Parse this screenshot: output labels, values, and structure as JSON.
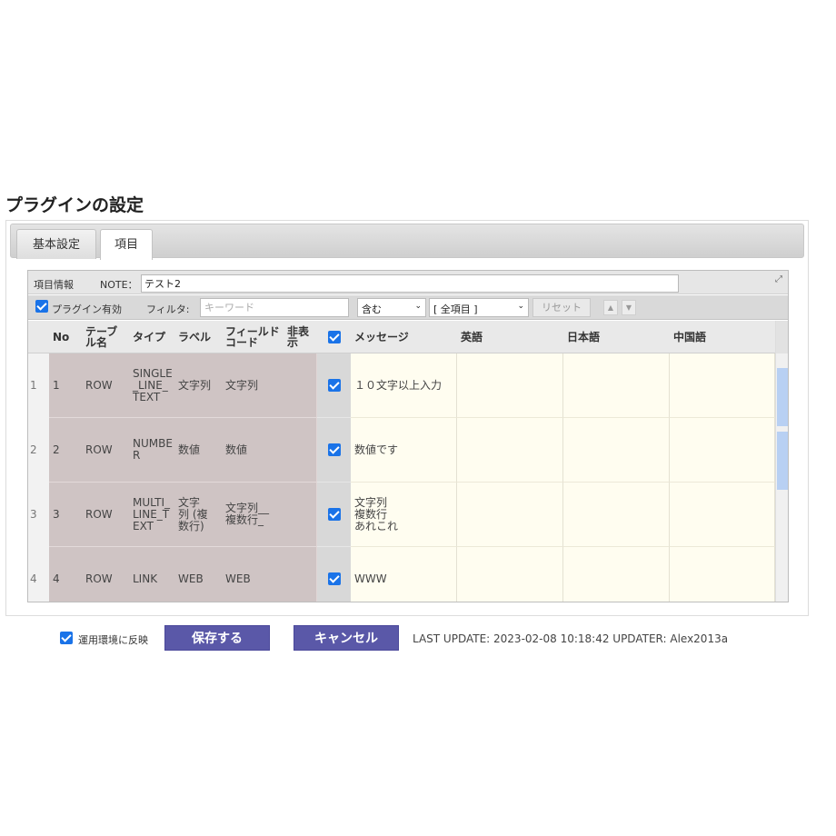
{
  "page": {
    "title": "プラグインの設定"
  },
  "tabs": [
    {
      "label": "基本設定",
      "active": false
    },
    {
      "label": "項目",
      "active": true
    }
  ],
  "grid": {
    "title_label": "項目情報",
    "note_label": "NOTE：",
    "note_value": "テスト2",
    "toolbar": {
      "plugin_enabled_label": "プラグイン有効",
      "plugin_enabled_checked": true,
      "filter_label": "フィルタ:",
      "keyword_placeholder": "キーワード",
      "match_mode": "含む",
      "field_scope": "[ 全項目 ]",
      "reset_label": "リセット"
    },
    "columns": {
      "no": "No",
      "table": "テーブ\nル名",
      "type": "タイプ",
      "label": "ラベル",
      "field_code": "フィールド\nコード",
      "hidden": "非表\n示",
      "message": "メッセージ",
      "en": "英語",
      "ja": "日本語",
      "zh": "中国語"
    },
    "rows": [
      {
        "rownum": "1",
        "no": "1",
        "table": "ROW",
        "type": "SINGLE\n_LINE_\nTEXT",
        "label": "文字列",
        "field_code": "文字列",
        "hidden": "",
        "checked": true,
        "message": "１０文字以上入力",
        "en": "",
        "ja": "",
        "zh": ""
      },
      {
        "rownum": "2",
        "no": "2",
        "table": "ROW",
        "type": "NUMBE\nR",
        "label": "数値",
        "field_code": "数値",
        "hidden": "",
        "checked": true,
        "message": "数値です",
        "en": "",
        "ja": "",
        "zh": ""
      },
      {
        "rownum": "3",
        "no": "3",
        "table": "ROW",
        "type": "MULTI_\nLINE_T\nEXT",
        "label": "文字\n列 (複\n数行)",
        "field_code": "文字列__\n複数行_",
        "hidden": "",
        "checked": true,
        "message": "文字列\n複数行\nあれこれ",
        "en": "",
        "ja": "",
        "zh": ""
      },
      {
        "rownum": "4",
        "no": "4",
        "table": "ROW",
        "type": "LINK",
        "label": "WEB",
        "field_code": "WEB",
        "hidden": "",
        "checked": true,
        "message": "WWW",
        "en": "",
        "ja": "",
        "zh": ""
      }
    ]
  },
  "footer": {
    "reflect_label": "運用環境に反映",
    "reflect_checked": true,
    "save_label": "保存する",
    "cancel_label": "キャンセル",
    "last_update": "LAST UPDATE: 2023-02-08 10:18:42 UPDATER: Alex2013a"
  },
  "colors": {
    "button": "#5a58a8",
    "checkbox": "#1a73e8",
    "readonly_cell": "#cfc4c4",
    "editable_cell": "#fffdf0"
  }
}
